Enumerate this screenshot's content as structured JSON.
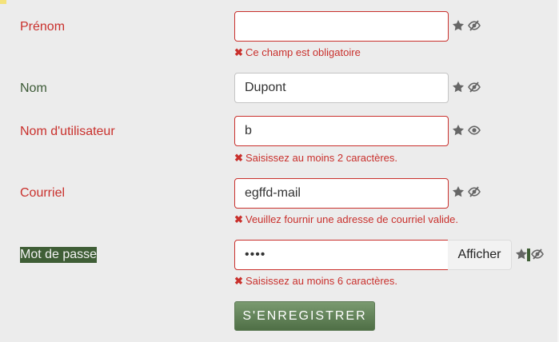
{
  "fields": {
    "prenom": {
      "label": "Prénom",
      "value": "",
      "error": "Ce champ est obligatoire",
      "icons": [
        "star-icon",
        "eye-slash-icon"
      ]
    },
    "nom": {
      "label": "Nom",
      "value": "Dupont",
      "icons": [
        "star-icon",
        "eye-slash-icon"
      ]
    },
    "username": {
      "label": "Nom d'utilisateur",
      "value": "b",
      "error": "Saisissez au moins 2 caractères.",
      "icons": [
        "star-icon",
        "eye-icon"
      ]
    },
    "email": {
      "label": "Courriel",
      "value": "egffd-mail",
      "error": "Veuillez fournir une adresse de courriel valide.",
      "icons": [
        "star-icon",
        "eye-slash-icon"
      ]
    },
    "password": {
      "label": "Mot de passe",
      "value": "••••",
      "show_label": "Afficher",
      "error": "Saisissez au moins 6 caractères.",
      "icons": [
        "star-icon",
        "eye-slash-icon"
      ]
    }
  },
  "submit": {
    "label": "S'ENREGISTRER"
  },
  "colors": {
    "error": "#c9302c",
    "valid_label": "#3c5a36",
    "button": "#5f7f55",
    "highlight": "#3f5e36",
    "background": "#ececec"
  }
}
